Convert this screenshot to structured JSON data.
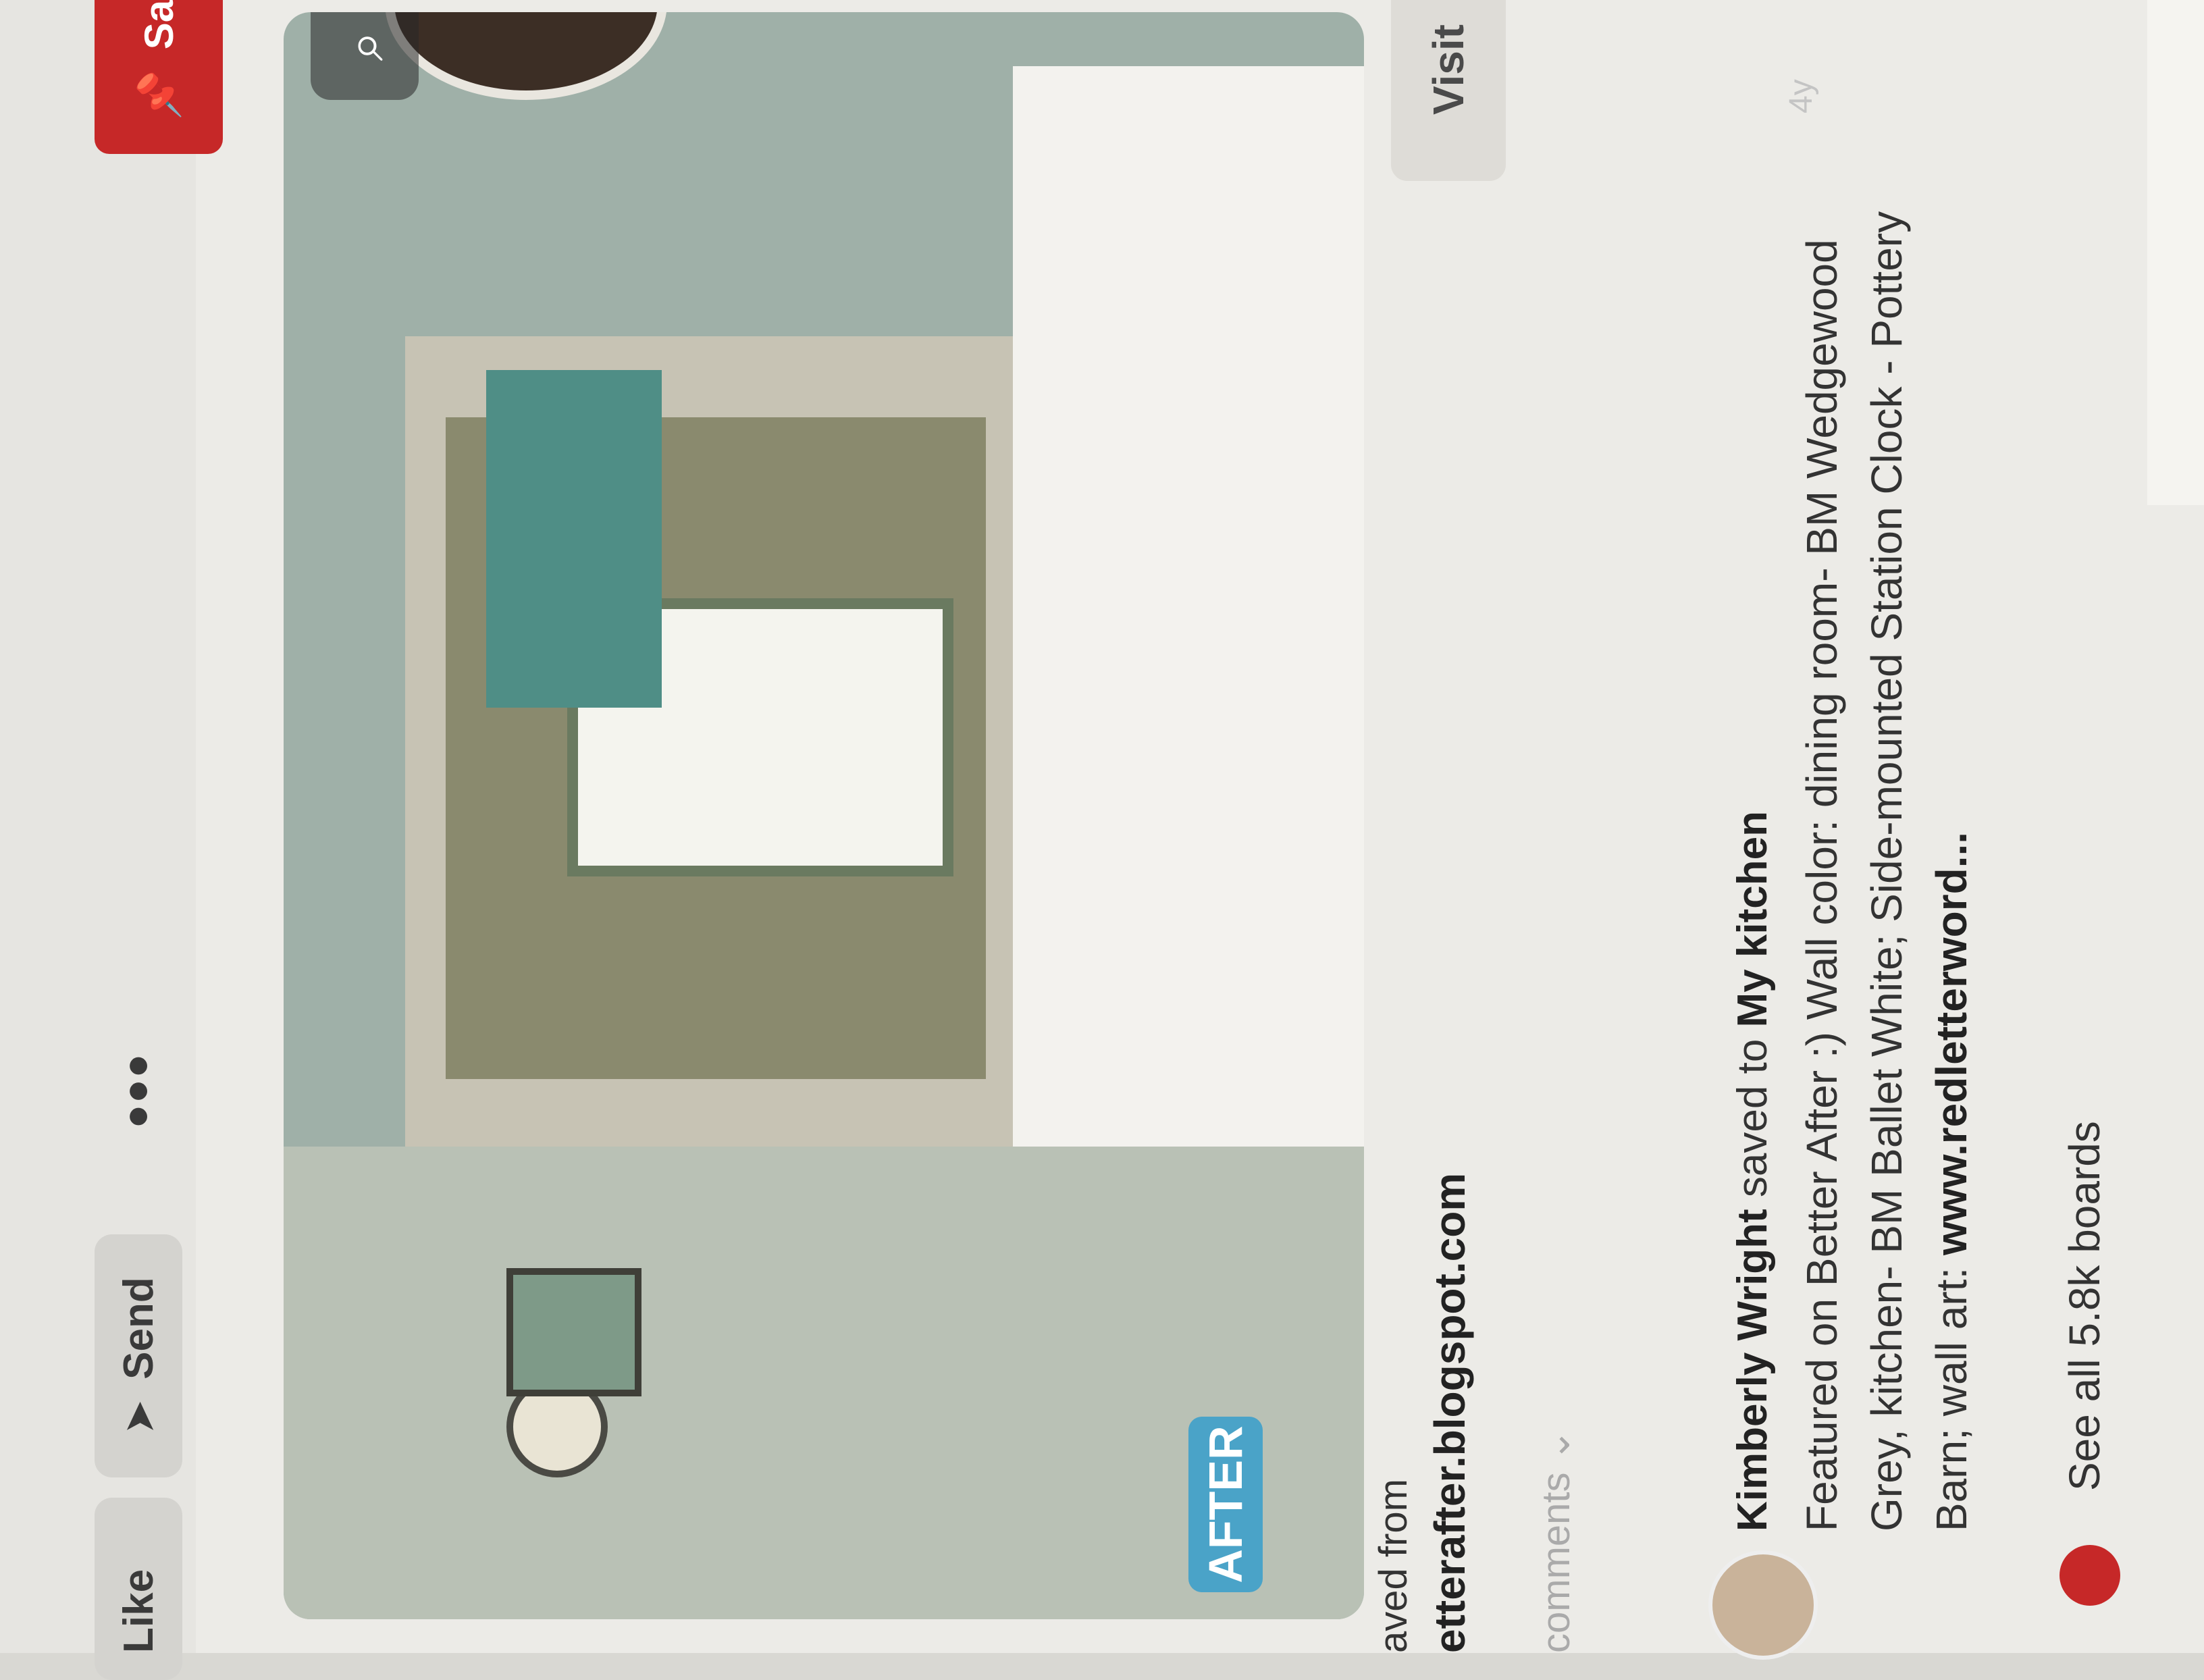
{
  "toolbar": {
    "like_label": "Like",
    "send_label": "Send",
    "more_label": "•••",
    "save_label": "Sa"
  },
  "pin": {
    "badge": "AFTER",
    "visit_label": "Visit",
    "timestamp": "4y"
  },
  "source": {
    "saved_from": "aved from",
    "domain": "etterafter.blogspot.com",
    "comments": "comments"
  },
  "activity": {
    "user_name": "Kimberly Wright",
    "saved_to_text": "saved to",
    "board_name": "My kitchen",
    "description": "Featured on Better After :) Wall color: dining room- BM Wedgewood Grey, kitchen- BM Ballet White; Side-mounted Station Clock - Pottery Barn; wall art:",
    "description_link": "www.redletterword...",
    "see_all": "See all 5.8k boards"
  },
  "icons": {
    "send": "paper-plane-icon",
    "save": "pushpin-icon",
    "lens": "visual-search-icon",
    "more": "ellipsis-icon"
  },
  "colors": {
    "save_red": "#c62828",
    "after_badge": "#4aa3c8"
  }
}
